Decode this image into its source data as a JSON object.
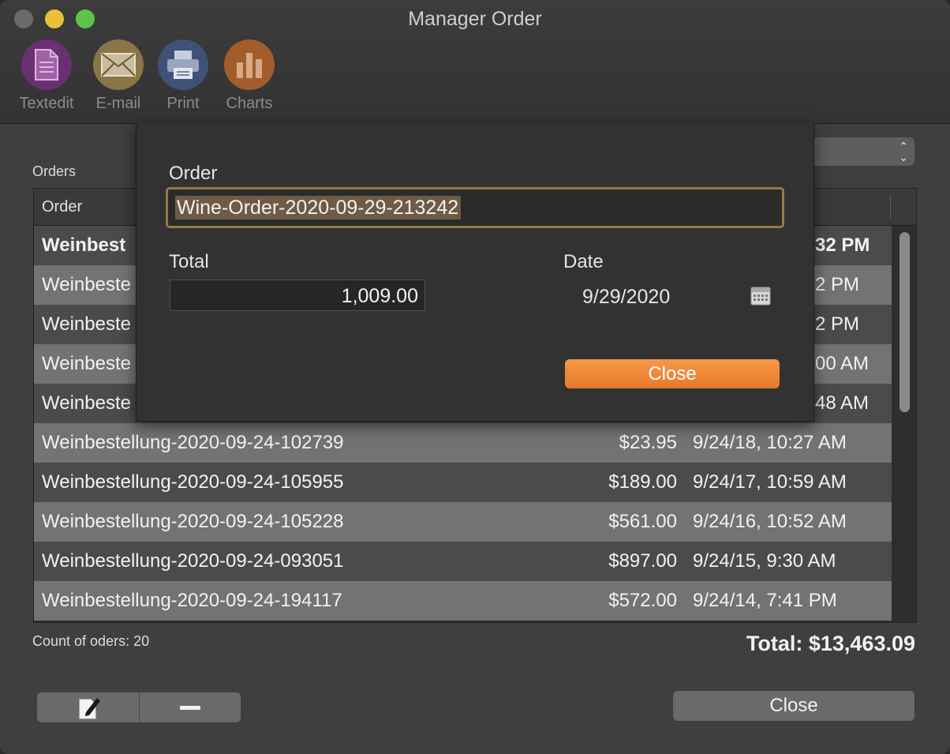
{
  "window": {
    "title": "Manager Order"
  },
  "toolbar": {
    "items": [
      {
        "label": "Textedit",
        "icon": "document-icon",
        "color": "#6b2f73"
      },
      {
        "label": "E-mail",
        "icon": "envelope-icon",
        "color": "#8a7546"
      },
      {
        "label": "Print",
        "icon": "printer-icon",
        "color": "#3e5279"
      },
      {
        "label": "Charts",
        "icon": "bar-chart-icon",
        "color": "#a35c2c"
      }
    ]
  },
  "orders": {
    "label": "Orders",
    "column_order": "Order",
    "rows": [
      {
        "name": "Weinbest",
        "amount": "",
        "date": "32 PM",
        "bold": true
      },
      {
        "name": "Weinbeste",
        "amount": "",
        "date": "2 PM"
      },
      {
        "name": "Weinbeste",
        "amount": "",
        "date": "2 PM"
      },
      {
        "name": "Weinbeste",
        "amount": "",
        "date": "00 AM"
      },
      {
        "name": "Weinbeste",
        "amount": "",
        "date": "48 AM"
      },
      {
        "name": "Weinbestellung-2020-09-24-102739",
        "amount": "$23.95",
        "date": "9/24/18, 10:27 AM"
      },
      {
        "name": "Weinbestellung-2020-09-24-105955",
        "amount": "$189.00",
        "date": "9/24/17, 10:59 AM"
      },
      {
        "name": "Weinbestellung-2020-09-24-105228",
        "amount": "$561.00",
        "date": "9/24/16, 10:52 AM"
      },
      {
        "name": "Weinbestellung-2020-09-24-093051",
        "amount": "$897.00",
        "date": "9/24/15, 9:30 AM"
      },
      {
        "name": "Weinbestellung-2020-09-24-194117",
        "amount": "$572.00",
        "date": "9/24/14, 7:41 PM"
      }
    ],
    "count_label": "Count of oders: 20",
    "total_label": "Total: $13,463.09"
  },
  "footer": {
    "close_label": "Close"
  },
  "sheet": {
    "order_label": "Order",
    "order_value": "Wine-Order-2020-09-29-213242",
    "total_label": "Total",
    "total_value": "1,009.00",
    "date_label": "Date",
    "date_value": "9/29/2020",
    "close_label": "Close"
  },
  "colors": {
    "accent": "#f0882f",
    "focus_ring": "#9a7844"
  }
}
